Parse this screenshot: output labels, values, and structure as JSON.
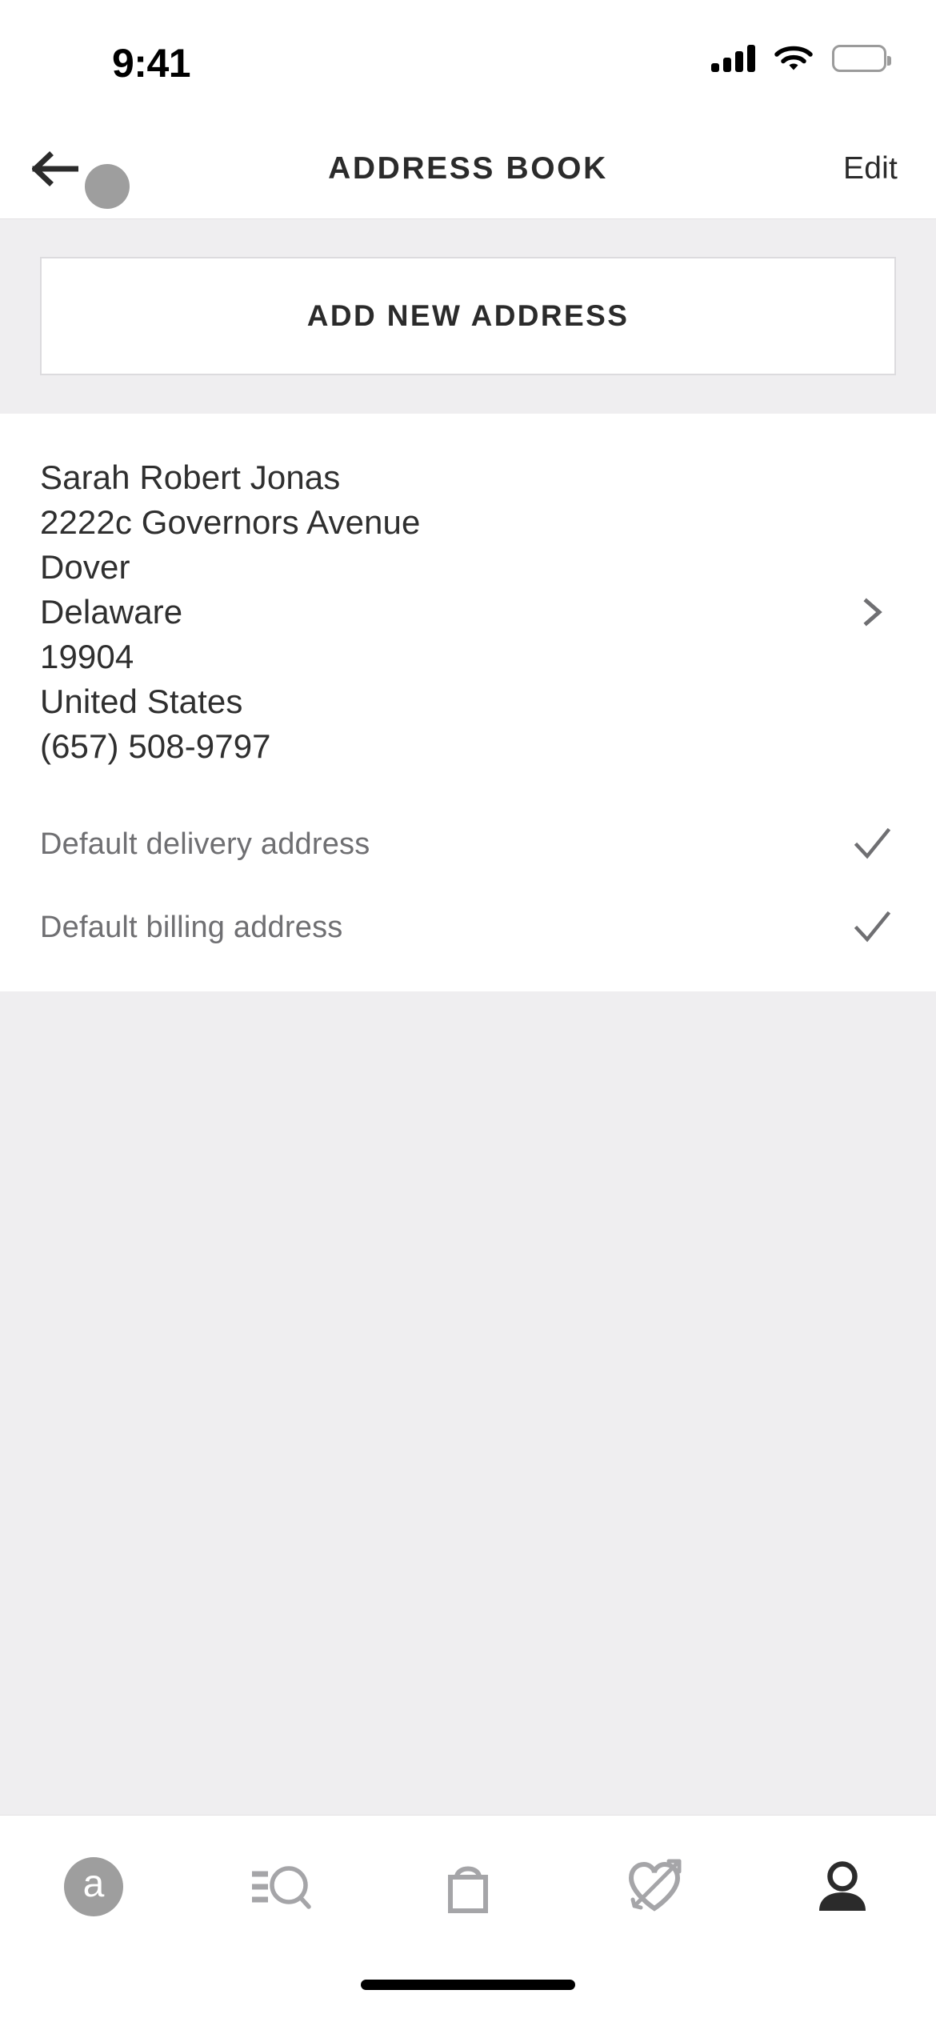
{
  "status_bar": {
    "time": "9:41",
    "cellular_icon": "cellular-signal-icon",
    "wifi_icon": "wifi-icon",
    "battery_icon": "battery-full-icon"
  },
  "header": {
    "back_icon": "back-arrow-icon",
    "touch_indicator": "touch-point-indicator",
    "title": "ADDRESS BOOK",
    "edit_label": "Edit"
  },
  "add_address": {
    "label": "ADD NEW ADDRESS"
  },
  "address": {
    "lines": [
      "Sarah Robert Jonas",
      "2222c Governors Avenue",
      "Dover",
      "Delaware",
      "19904",
      "United States",
      "(657) 508-9797"
    ],
    "chevron_icon": "chevron-right-icon",
    "flags": [
      {
        "label": "Default delivery address",
        "checked": true,
        "icon": "check-icon"
      },
      {
        "label": "Default billing address",
        "checked": true,
        "icon": "check-icon"
      }
    ]
  },
  "tab_bar": {
    "items": [
      {
        "name": "home",
        "icon": "asos-logo-icon",
        "glyph": "a",
        "active": false
      },
      {
        "name": "search",
        "icon": "search-list-icon",
        "active": false
      },
      {
        "name": "bag",
        "icon": "shopping-bag-icon",
        "active": false
      },
      {
        "name": "saved",
        "icon": "heart-arrow-icon",
        "active": false
      },
      {
        "name": "account",
        "icon": "person-icon",
        "active": true
      }
    ]
  },
  "home_indicator": {
    "name": "home-indicator"
  },
  "colors": {
    "page_background": "#EFEEF0",
    "card_background": "#FFFFFF",
    "primary_text": "#2B2B2B",
    "secondary_text": "#6F6F72",
    "icon_inactive": "#A5A5A8",
    "icon_active": "#2B2B2B",
    "border": "#DCDBDE"
  }
}
